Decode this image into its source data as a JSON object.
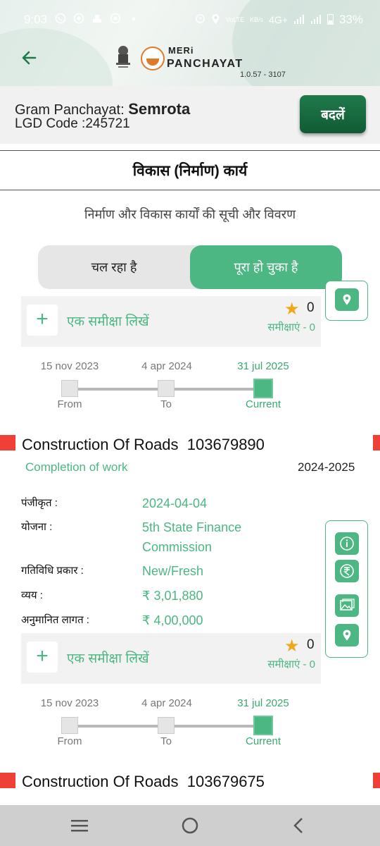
{
  "status_bar": {
    "time": "9:03",
    "network": "4G+",
    "battery": "33%",
    "icons_left": [
      "whatsapp-icon",
      "chrome-icon",
      "notification-icon",
      "chrome-icon",
      "dot-icon"
    ],
    "icons_right": [
      "alarm-icon",
      "location-icon",
      "volte-icon",
      "data-speed-icon",
      "signal-icon",
      "signal-icon",
      "battery-icon"
    ]
  },
  "header": {
    "brand_line1": "MERi",
    "brand_line2": "PANCHAYAT",
    "version": "1.0.57 - 3107"
  },
  "panchayat": {
    "label": "Gram Panchayat:",
    "name": "Semrota",
    "lgd_label": "LGD Code :",
    "lgd_code": "245721",
    "change_button": "बदलें"
  },
  "page": {
    "title": "विकास (निर्माण) कार्य",
    "subtitle": "निर्माण और विकास कार्यों की सूची और विवरण"
  },
  "tabs": {
    "ongoing": "चल रहा है",
    "completed": "पूरा हो चुका है",
    "active": "completed"
  },
  "review": {
    "write_label": "एक समीक्षा लिखें",
    "rating": "0",
    "count_label": "समीक्षाएं - 0"
  },
  "timeline": {
    "dates": [
      "15 nov 2023",
      "4 apr 2024",
      "31 jul 2025"
    ],
    "labels": [
      "From",
      "To",
      "Current"
    ]
  },
  "works": [
    {
      "title": "Construction Of Roads",
      "id": "103679890",
      "status": "Completion of work",
      "year": "2024-2025",
      "details": [
        {
          "label": "पंजीकृत :",
          "value": "2024-04-04"
        },
        {
          "label": "योजना :",
          "value": "5th State Finance Commission"
        },
        {
          "label": "गतिविधि प्रकार :",
          "value": "New/Fresh"
        },
        {
          "label": "व्यय :",
          "value": "₹ 3,01,880"
        },
        {
          "label": "अनुमानित लागत :",
          "value": "₹ 4,00,000"
        }
      ]
    },
    {
      "title": "Construction Of Roads",
      "id": "103679675"
    }
  ],
  "colors": {
    "accent": "#4cb782",
    "button_dark": "#1f7a4a",
    "marker_red": "#ee4036"
  }
}
